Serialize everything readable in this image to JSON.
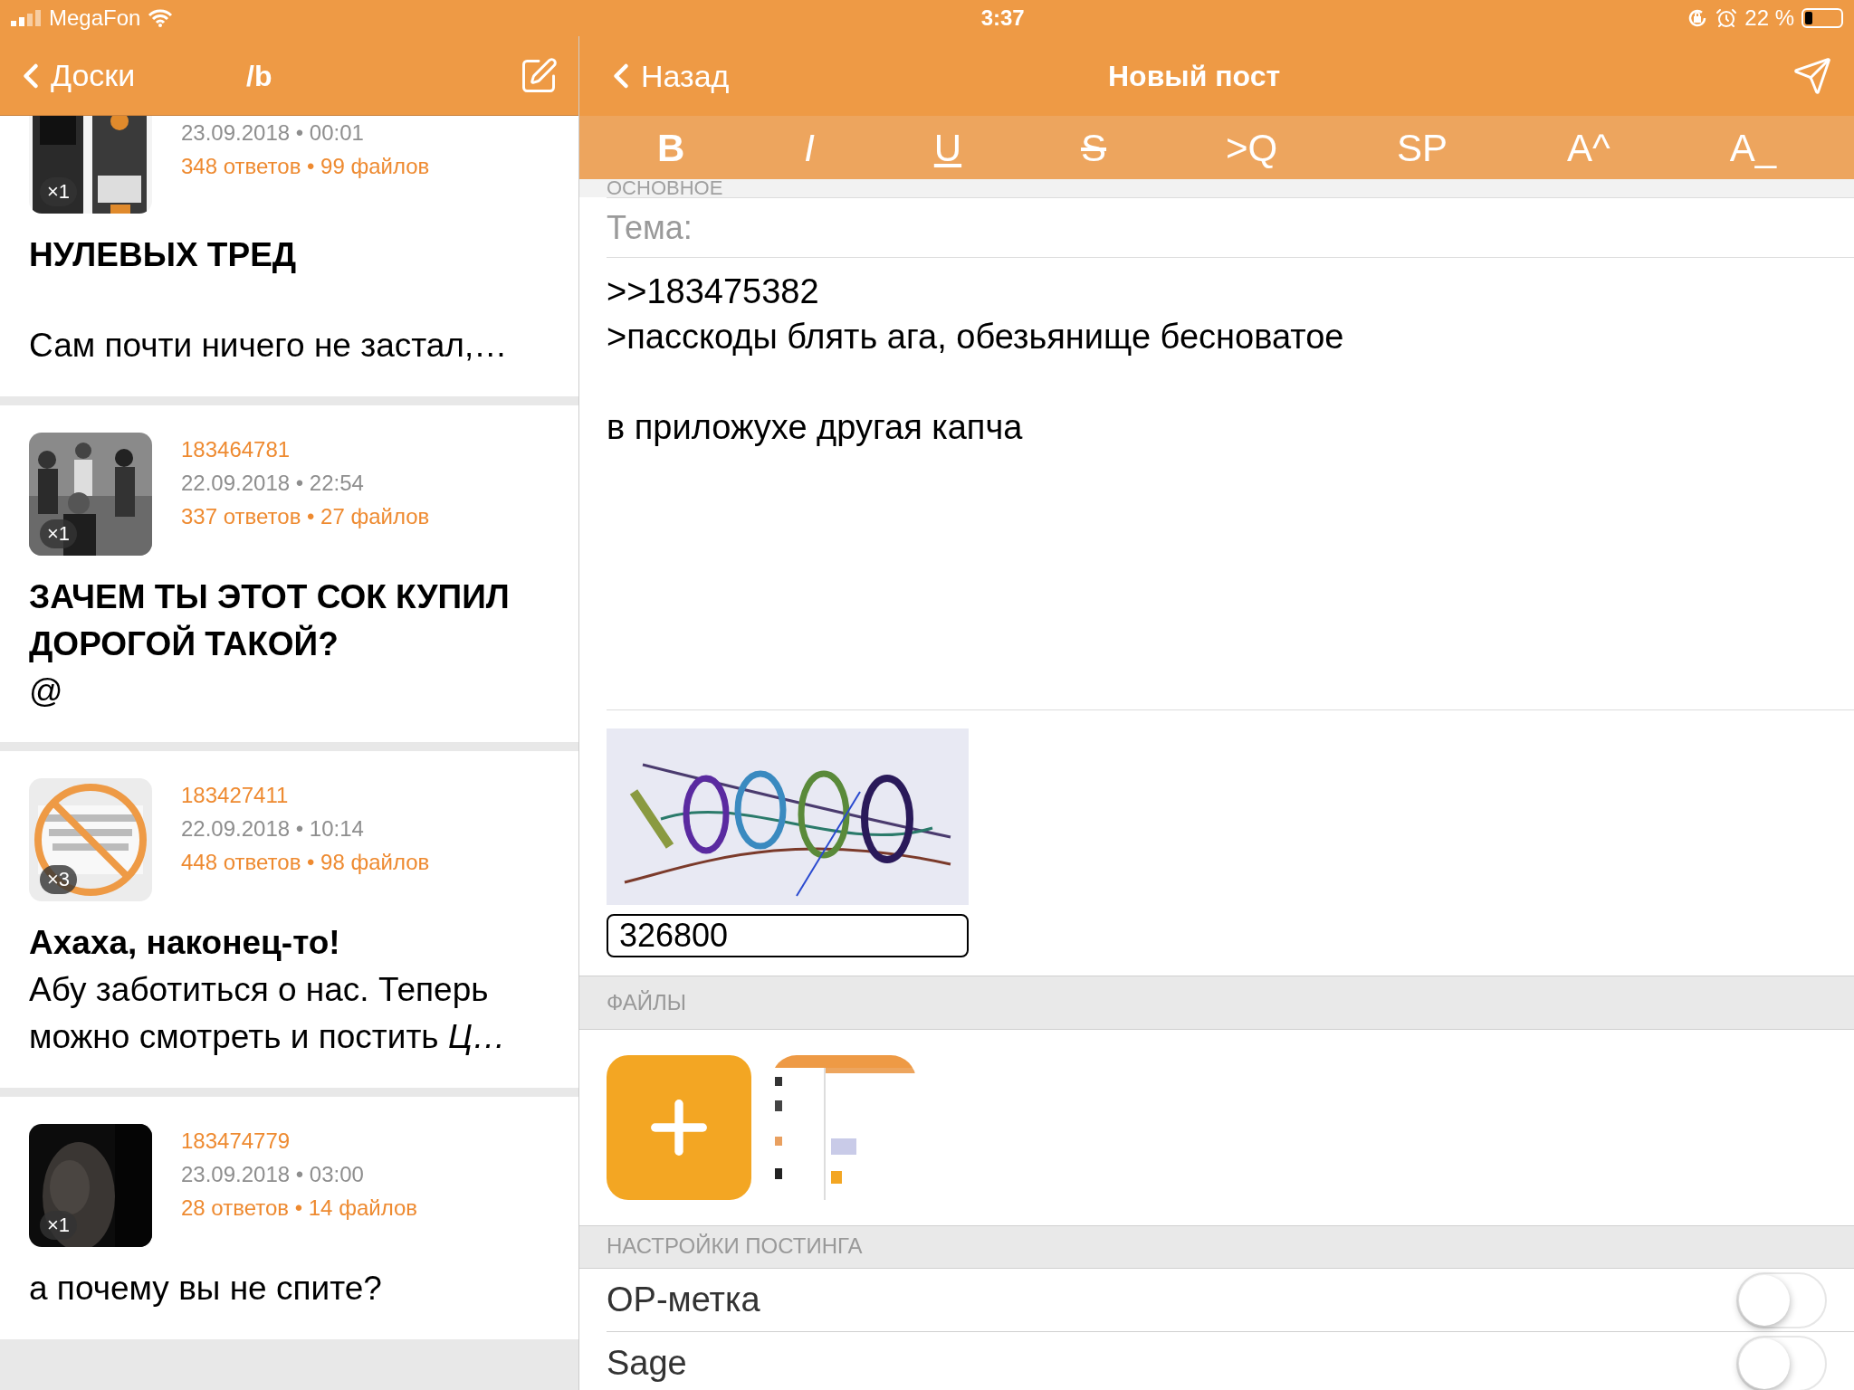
{
  "status_bar": {
    "carrier": "MegaFon",
    "time": "3:37",
    "battery_text": "22 %",
    "battery": {
      "level": 0.22
    }
  },
  "left_nav": {
    "back": "Доски",
    "title": "/b"
  },
  "threads": [
    {
      "date": "23.09.2018 • 00:01",
      "counts": "348 ответов • 99 файлов",
      "badge": "×1",
      "title": "НУЛЕВЫХ ТРЕД",
      "body": "Сам почти ничего не застал,…"
    },
    {
      "id": "183464781",
      "date": "22.09.2018 • 22:54",
      "counts": "337 ответов • 27 файлов",
      "badge": "×1",
      "title": "ЗАЧЕМ ТЫ ЭТОТ СОК КУПИЛ ДОРОГОЙ ТАКОЙ?",
      "body": "@"
    },
    {
      "id": "183427411",
      "date": "22.09.2018 • 10:14",
      "counts": "448 ответов • 98 файлов",
      "badge": "×3",
      "title": "Ахаха, наконец-то!",
      "body": "Абу заботиться о нас. Теперь можно смотреть и постить *Ц…*"
    },
    {
      "id": "183474779",
      "date": "23.09.2018 • 03:00",
      "counts": "28 ответов • 14 файлов",
      "badge": "×1",
      "body": "а почему вы не спите?"
    }
  ],
  "right_nav": {
    "back": "Назад",
    "title": "Новый пост"
  },
  "format_buttons": [
    {
      "label": "B",
      "kind": "bold"
    },
    {
      "label": "I",
      "kind": "italic"
    },
    {
      "label": "U",
      "kind": "underline"
    },
    {
      "label": "S",
      "kind": "strike"
    },
    {
      "label": ">Q",
      "kind": "plain"
    },
    {
      "label": "SP",
      "kind": "plain"
    },
    {
      "label": "A^",
      "kind": "plain"
    },
    {
      "label": "A_",
      "kind": "plain"
    }
  ],
  "section_main": "ОСНОВНОЕ",
  "subject": {
    "placeholder": "Тема:"
  },
  "message": ">>183475382\n>пасскоды блять ага, обезьянище бесноватое\n\nв приложухе другая капча",
  "captcha": {
    "value": "326800"
  },
  "section_files": "ФАЙЛЫ",
  "section_settings": "НАСТРОЙКИ ПОСТИНГА",
  "settings": [
    {
      "label": "OP-метка",
      "on": false
    },
    {
      "label": "Sage",
      "on": false
    }
  ]
}
